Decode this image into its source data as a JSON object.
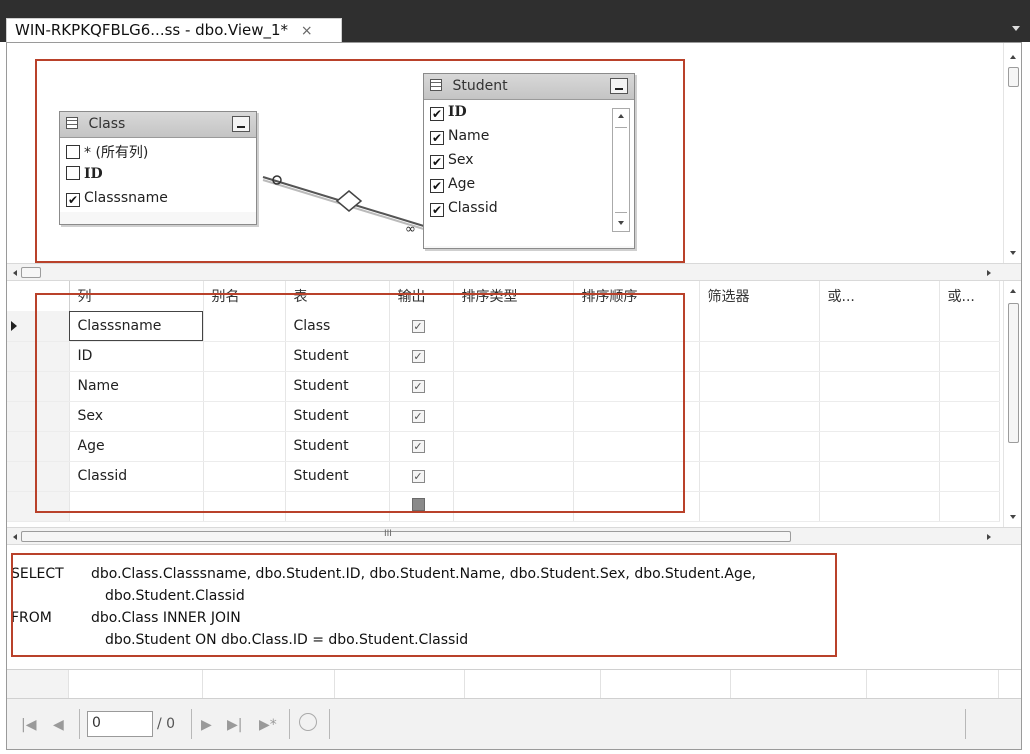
{
  "tab": {
    "title": "WIN-RKPKQFBLG6...ss - dbo.View_1*",
    "close": "×"
  },
  "diagram": {
    "class_table": {
      "title": "Class",
      "columns": [
        {
          "label": "* (所有列)",
          "checked": false,
          "bold": false
        },
        {
          "label": "ID",
          "checked": false,
          "bold": true
        },
        {
          "label": "Classsname",
          "checked": true,
          "bold": false
        }
      ]
    },
    "student_table": {
      "title": "Student",
      "columns": [
        {
          "label": "ID",
          "checked": true,
          "bold": true
        },
        {
          "label": "Name",
          "checked": true,
          "bold": false
        },
        {
          "label": "Sex",
          "checked": true,
          "bold": false
        },
        {
          "label": "Age",
          "checked": true,
          "bold": false
        },
        {
          "label": "Classid",
          "checked": true,
          "bold": false
        }
      ]
    }
  },
  "grid": {
    "headers": [
      "列",
      "别名",
      "表",
      "输出",
      "排序类型",
      "排序顺序",
      "筛选器",
      "或...",
      "或..."
    ],
    "rows": [
      {
        "column": "Classsname",
        "alias": "",
        "table": "Class",
        "output": true
      },
      {
        "column": "ID",
        "alias": "",
        "table": "Student",
        "output": true
      },
      {
        "column": "Name",
        "alias": "",
        "table": "Student",
        "output": true
      },
      {
        "column": "Sex",
        "alias": "",
        "table": "Student",
        "output": true
      },
      {
        "column": "Age",
        "alias": "",
        "table": "Student",
        "output": true
      },
      {
        "column": "Classid",
        "alias": "",
        "table": "Student",
        "output": true
      }
    ],
    "scroll_marker": "III"
  },
  "sql": {
    "select_kw": "SELECT",
    "select_line1": "dbo.Class.Classsname, dbo.Student.ID, dbo.Student.Name, dbo.Student.Sex, dbo.Student.Age,",
    "select_line2": "dbo.Student.Classid",
    "from_kw": "FROM",
    "from_line1": "dbo.Class INNER JOIN",
    "from_line2": "dbo.Student ON dbo.Class.ID = dbo.Student.Classid"
  },
  "nav": {
    "current_record": "0",
    "total": "/ 0"
  },
  "colors": {
    "highlight": "#b9412a",
    "tab_strip": "#2f2f2f"
  }
}
